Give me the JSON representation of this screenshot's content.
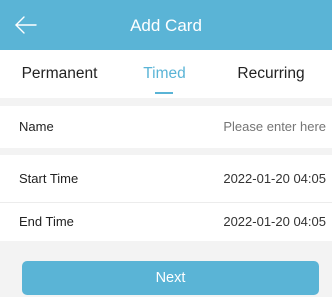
{
  "header": {
    "title": "Add Card",
    "back_icon": "arrow-left-icon",
    "background_color": "#5ab4d6"
  },
  "tabs": [
    {
      "label": "Permanent",
      "active": false
    },
    {
      "label": "Timed",
      "active": true
    },
    {
      "label": "Recurring",
      "active": false
    }
  ],
  "form": {
    "name": {
      "label": "Name",
      "value": "",
      "placeholder": "Please enter here"
    },
    "start_time": {
      "label": "Start Time",
      "value": "2022-01-20 04:05"
    },
    "end_time": {
      "label": "End Time",
      "value": "2022-01-20 04:05"
    }
  },
  "actions": {
    "next_label": "Next"
  },
  "colors": {
    "accent": "#5ab4d6",
    "background": "#f3f3f3"
  }
}
